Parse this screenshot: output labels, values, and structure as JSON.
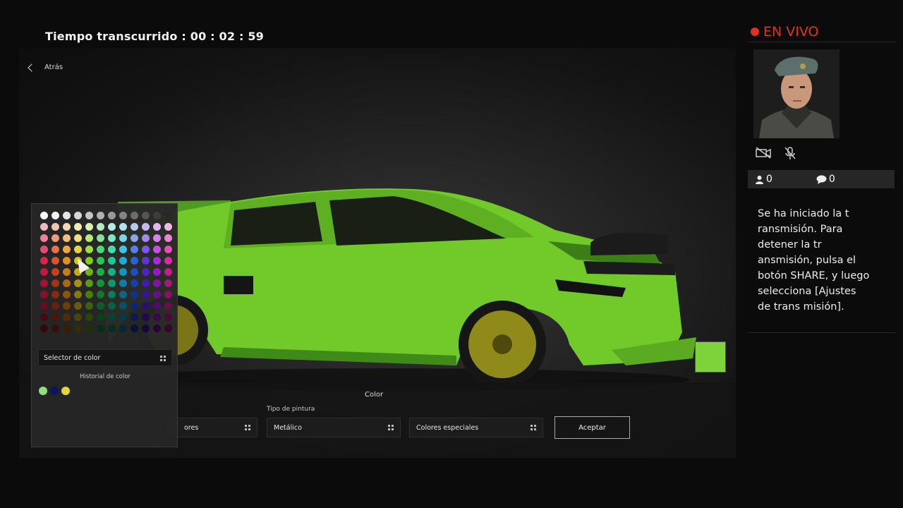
{
  "elapsed": {
    "label": "Tiempo transcurrido :",
    "value": "00 : 02 : 59"
  },
  "nav": {
    "back_label": "Atrás"
  },
  "palette": {
    "rows": [
      [
        "#ffffff",
        "#f4f4f4",
        "#e6e6e6",
        "#d6d6d6",
        "#c4c4c4",
        "#b0b0b0",
        "#9a9a9a",
        "#838383",
        "#6c6c6c",
        "#555555",
        "#3e3e3e",
        "#282828"
      ],
      [
        "#f3b8c8",
        "#f3c3b6",
        "#f5d6b0",
        "#f2ecaf",
        "#d8f0b0",
        "#b6ecc2",
        "#b0eedf",
        "#b2e2f2",
        "#b6c8f5",
        "#c6b8f5",
        "#e2b6f2",
        "#f2b6e2"
      ],
      [
        "#ee7f9f",
        "#ee9a82",
        "#f2be7c",
        "#eee07a",
        "#bbe77a",
        "#82e29a",
        "#7ce6c9",
        "#7ed2ec",
        "#86a4f0",
        "#a486f0",
        "#d282ec",
        "#ec82cf"
      ],
      [
        "#e64a72",
        "#e6714c",
        "#eea542",
        "#e8d442",
        "#9ede42",
        "#4ed874",
        "#42dcb3",
        "#44c2e6",
        "#5480ea",
        "#8254ea",
        "#c44ee6",
        "#e64cbc"
      ],
      [
        "#d8244e",
        "#d8522a",
        "#e0901e",
        "#d8c21e",
        "#84cc1e",
        "#26c656",
        "#1ec89c",
        "#20aad8",
        "#2a60dc",
        "#6430dc",
        "#ac28d8",
        "#d82aa4"
      ],
      [
        "#c21a3c",
        "#c2401e",
        "#ca7c14",
        "#c2ac14",
        "#6eb614",
        "#1aae46",
        "#14b286",
        "#1694c2",
        "#1e4cc6",
        "#5022c6",
        "#961cc2",
        "#c21e90"
      ],
      [
        "#a41432",
        "#a43418",
        "#aa6810",
        "#a49210",
        "#5c9a10",
        "#14943a",
        "#109670",
        "#127ca4",
        "#183fa8",
        "#421ca8",
        "#7e16a4",
        "#a41878"
      ],
      [
        "#861028",
        "#862a12",
        "#8c540c",
        "#86780c",
        "#4a7e0c",
        "#10782e",
        "#0c7a5c",
        "#0e6486",
        "#12328a",
        "#36168a",
        "#661286",
        "#861262"
      ],
      [
        "#680c1e",
        "#68200e",
        "#6c4008",
        "#685c08",
        "#3a6208",
        "#0c5c24",
        "#085e46",
        "#0a4e68",
        "#0e266c",
        "#2a106c",
        "#4e0e68",
        "#680e4c"
      ],
      [
        "#4a0816",
        "#4a160a",
        "#4e2e06",
        "#4a4206",
        "#2a4606",
        "#084218",
        "#064232",
        "#06384a",
        "#0a1c4e",
        "#1e0c4e",
        "#380a4a",
        "#4a0a36"
      ],
      [
        "#340612",
        "#341008",
        "#362004",
        "#342e04",
        "#1e3204",
        "#062e12",
        "#042e24",
        "#042834",
        "#061436",
        "#160836",
        "#280634",
        "#340628"
      ]
    ],
    "selector_label": "Selector de color",
    "history_label": "Historial de color",
    "history": [
      "#8fe07a",
      "#0a1560",
      "#e8d43a"
    ]
  },
  "bottombar": {
    "title": "Color",
    "paint_type_label": "Tipo de pintura",
    "dd_left": "ores",
    "dd_paint": "Metálico",
    "dd_special": "Colores especiales",
    "accept": "Aceptar"
  },
  "preview_color": "#7ed23a",
  "panel": {
    "live_label": "EN VIVO",
    "viewers": "0",
    "comments": "0",
    "message": "Se ha iniciado la t ransmisión. Para detener la tr ansmisión, pulsa el botón SHARE, y luego selecciona [Ajustes de trans misión]."
  }
}
